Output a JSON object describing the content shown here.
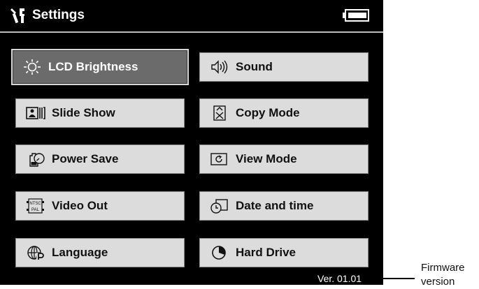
{
  "title": "Settings",
  "menu": {
    "lcd_brightness": "LCD Brightness",
    "sound": "Sound",
    "slide_show": "Slide Show",
    "copy_mode": "Copy Mode",
    "power_save": "Power Save",
    "view_mode": "View Mode",
    "video_out": "Video Out",
    "date_time": "Date and time",
    "language": "Language",
    "hard_drive": "Hard Drive"
  },
  "icons": {
    "title": "settings-tools-icon",
    "battery": "battery-icon",
    "lcd_brightness": "sun-icon",
    "sound": "speaker-icon",
    "slide_show": "slideshow-icon",
    "copy_mode": "copy-mode-icon",
    "power_save": "power-save-icon",
    "view_mode": "view-mode-icon",
    "video_out": "ntsc-pal-icon",
    "date_time": "clock-icon",
    "language": "globe-icon",
    "hard_drive": "hard-drive-icon"
  },
  "video_icon_text": {
    "top": "NTSC",
    "bottom": "PAL"
  },
  "selected": "lcd_brightness",
  "version": "Ver. 01.01",
  "callout": {
    "line1": "Firmware",
    "line2": "version"
  }
}
